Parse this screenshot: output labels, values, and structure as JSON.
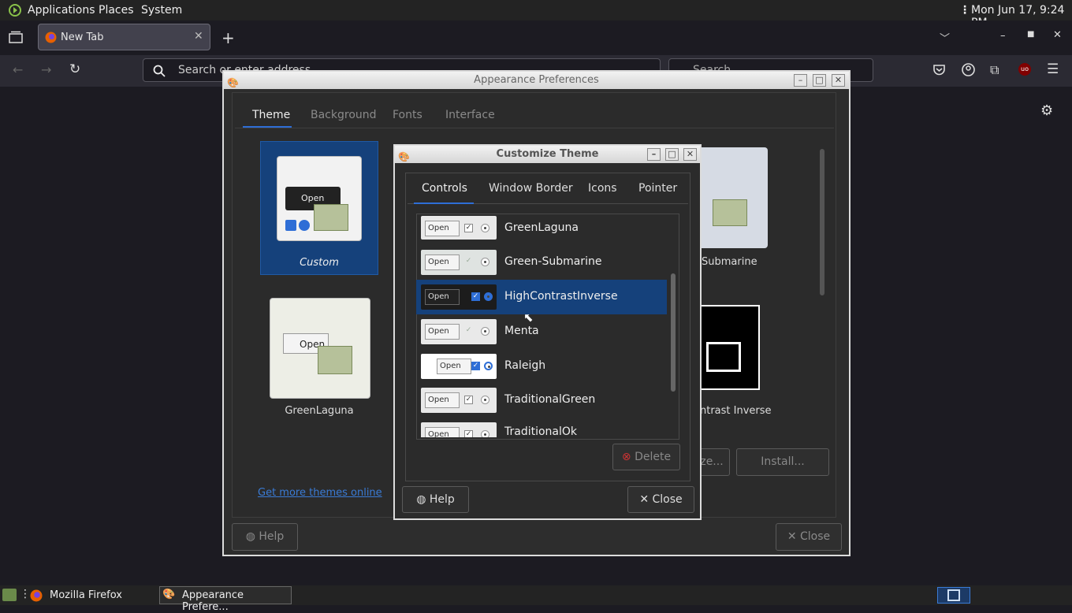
{
  "panel": {
    "applications": "Applications",
    "places": "Places",
    "system": "System",
    "clock": "Mon Jun 17,  9:24 PM"
  },
  "firefox": {
    "tab_title": "New Tab",
    "url_placeholder": "Search or enter address",
    "search_placeholder": "Search"
  },
  "appearance": {
    "title": "Appearance Preferences",
    "tabs": [
      "Theme",
      "Background",
      "Fonts",
      "Interface"
    ],
    "themes": [
      "Custom",
      "GreenLaguna",
      "Submarine",
      "ntrast Inverse"
    ],
    "get_more": "Get more themes online",
    "customize_label": "ze...",
    "install_label": "Install...",
    "help_label": "Help",
    "close_label": "Close"
  },
  "customize": {
    "title": "Customize Theme",
    "tabs": [
      "Controls",
      "Window Border",
      "Icons",
      "Pointer"
    ],
    "open_label": "Open",
    "themes": [
      "GreenLaguna",
      "Green-Submarine",
      "HighContrastInverse",
      "Menta",
      "Raleigh",
      "TraditionalGreen",
      "TraditionalOk"
    ],
    "selected": "HighContrastInverse",
    "delete_label": "Delete",
    "help_label": "Help",
    "close_label": "Close"
  },
  "taskbar": {
    "firefox": "Mozilla Firefox",
    "appearance": "Appearance Prefere..."
  },
  "colors": {
    "selection": "#15417b",
    "accent": "#2e6ed6"
  }
}
